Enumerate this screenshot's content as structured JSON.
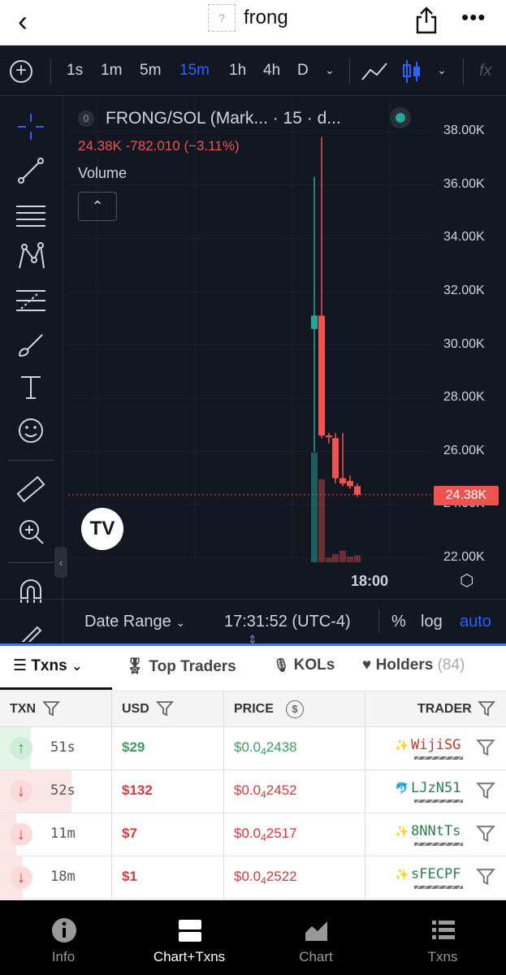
{
  "nav": {
    "back_glyph": "‹",
    "token_placeholder": "?",
    "title": "frong",
    "more_glyph": "•••"
  },
  "toolbar": {
    "intervals": [
      "1s",
      "1m",
      "5m",
      "15m",
      "1h",
      "4h",
      "D"
    ],
    "active_interval": "15m",
    "fx": "fx"
  },
  "legend": {
    "index": "0",
    "title": "FRONG/SOL (Mark... · 15 · d...",
    "ohlc": "24.38K  -782.010 (−3.11%)",
    "volume_label": "Volume",
    "collapse_glyph": "⌃"
  },
  "chart_data": {
    "type": "candlestick",
    "y_axis_labels": [
      "38.00K",
      "36.00K",
      "34.00K",
      "32.00K",
      "30.00K",
      "28.00K",
      "26.00K",
      "24.00K",
      "22.00K"
    ],
    "ylim": [
      21700,
      38500
    ],
    "last_price_label": "24.38K",
    "last_price": 24380,
    "x_label": "18:00",
    "candles": [
      {
        "open": 30600,
        "close": 31100,
        "high": 36300,
        "low": 26000,
        "dir": "up",
        "volume": 0.95
      },
      {
        "open": 31100,
        "close": 26600,
        "high": 37800,
        "low": 26500,
        "dir": "down",
        "volume": 0.72
      },
      {
        "open": 26600,
        "close": 26550,
        "high": 26700,
        "low": 26300,
        "dir": "down",
        "volume": 0.04
      },
      {
        "open": 26500,
        "close": 25000,
        "high": 26700,
        "low": 24800,
        "dir": "down",
        "volume": 0.07
      },
      {
        "open": 25000,
        "close": 24800,
        "high": 26700,
        "low": 24700,
        "dir": "down",
        "volume": 0.1
      },
      {
        "open": 24900,
        "close": 24700,
        "high": 25100,
        "low": 24600,
        "dir": "down",
        "volume": 0.05
      },
      {
        "open": 24700,
        "close": 24380,
        "high": 24800,
        "low": 24300,
        "dir": "down",
        "volume": 0.06
      }
    ]
  },
  "chart_bottom": {
    "date_range": "Date Range",
    "chevron": "⌄",
    "time": "17:31:52 (UTC-4)",
    "percent": "%",
    "log": "log",
    "auto": "auto"
  },
  "tv_logo": "TV",
  "tabs": [
    {
      "label": "Txns",
      "active": true
    },
    {
      "label": "Top Traders"
    },
    {
      "label": "KOLs"
    },
    {
      "label": "Holders"
    }
  ],
  "holders_count": "(84)",
  "table": {
    "headers": {
      "txn": "TXN",
      "usd": "USD",
      "price": "PRICE",
      "trader": "TRADER"
    },
    "rows": [
      {
        "type": "buy",
        "age": "51s",
        "usd": "$29",
        "price_prefix": "$0.0",
        "price_sub": "4",
        "price_rest": "2438",
        "trader": "WijiSG",
        "trader_icon": "✨"
      },
      {
        "type": "sell",
        "age": "52s",
        "usd": "$132",
        "price_prefix": "$0.0",
        "price_sub": "4",
        "price_rest": "2452",
        "trader": "LJzN51",
        "trader_icon": "🐬"
      },
      {
        "type": "sell",
        "age": "11m",
        "usd": "$7",
        "price_prefix": "$0.0",
        "price_sub": "4",
        "price_rest": "2517",
        "trader": "8NNtTs",
        "trader_icon": "✨"
      },
      {
        "type": "sell",
        "age": "18m",
        "usd": "$1",
        "price_prefix": "$0.0",
        "price_sub": "4",
        "price_rest": "2522",
        "trader": "sFECPF",
        "trader_icon": "✨"
      }
    ]
  },
  "bottom_nav": [
    {
      "label": "Info"
    },
    {
      "label": "Chart+Txns",
      "active": true
    },
    {
      "label": "Chart"
    },
    {
      "label": "Txns"
    }
  ],
  "colors": {
    "up": "#26a69a",
    "down": "#ef5350",
    "accent": "#2962ff"
  }
}
